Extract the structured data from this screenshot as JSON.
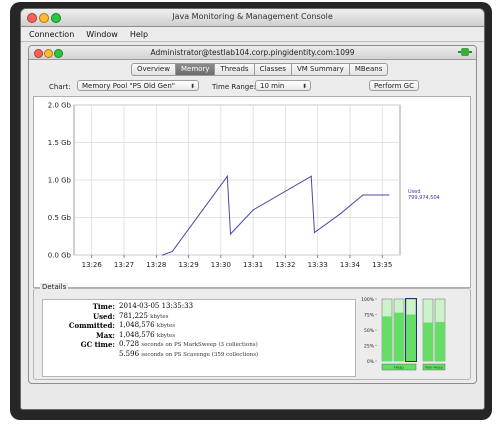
{
  "window": {
    "title": "Java Monitoring & Management Console",
    "menu": [
      "Connection",
      "Window",
      "Help"
    ]
  },
  "connection": {
    "title": "Administrator@testlab104.corp.pingidentity.com:1099"
  },
  "tabs": [
    {
      "label": "Overview",
      "active": false
    },
    {
      "label": "Memory",
      "active": true
    },
    {
      "label": "Threads",
      "active": false
    },
    {
      "label": "Classes",
      "active": false
    },
    {
      "label": "VM Summary",
      "active": false
    },
    {
      "label": "MBeans",
      "active": false
    }
  ],
  "controls": {
    "chart_label": "Chart:",
    "chart_value": "Memory Pool \"PS Old Gen\"",
    "range_label": "Time Range:",
    "range_value": "10 min",
    "gc_button": "Perform GC"
  },
  "chart_data": {
    "type": "line",
    "y_ticks": [
      "0.0 Gb",
      "0.5 Gb",
      "1.0 Gb",
      "1.5 Gb",
      "2.0 Gb"
    ],
    "x_ticks": [
      "13:26",
      "13:27",
      "13:28",
      "13:29",
      "13:30",
      "13:31",
      "13:32",
      "13:33",
      "13:34",
      "13:35"
    ],
    "ylim": [
      0,
      2.0
    ],
    "series": [
      {
        "name": "Used",
        "color": "#4a4aa8",
        "x": [
          "13:28.2",
          "13:28.5",
          "13:30.2",
          "13:30.3",
          "13:31.0",
          "13:32.8",
          "13:32.9",
          "13:33.7",
          "13:34.4",
          "13:35.0",
          "13:35.2"
        ],
        "values": [
          0.0,
          0.05,
          1.05,
          0.28,
          0.6,
          1.05,
          0.3,
          0.55,
          0.8,
          0.8,
          0.8
        ]
      }
    ],
    "legend_label": "Used",
    "legend_value": "799,974,504",
    "grid": true
  },
  "details": {
    "title": "Details",
    "rows": [
      {
        "label": "Time:",
        "value": "2014-03-05 13:35:33",
        "unit": ""
      },
      {
        "label": "Used:",
        "value": "781,225",
        "unit": "kbytes"
      },
      {
        "label": "Committed:",
        "value": "1,048,576",
        "unit": "kbytes"
      },
      {
        "label": "Max:",
        "value": "1,048,576",
        "unit": "kbytes"
      },
      {
        "label": "GC time:",
        "value": "0.728",
        "unit": "seconds on PS MarkSweep (3 collections)"
      },
      {
        "label": "",
        "value": "5.596",
        "unit": "seconds on PS Scavenge (359 collections)"
      }
    ]
  },
  "heap_bars": {
    "y_ticks": [
      "100%",
      "75%",
      "50%",
      "25%",
      "0%"
    ],
    "groups": [
      {
        "label": "Heap",
        "bars": [
          0.72,
          0.78,
          0.75
        ]
      },
      {
        "label": "Non-Heap",
        "bars": [
          0.62,
          0.63
        ]
      }
    ]
  }
}
